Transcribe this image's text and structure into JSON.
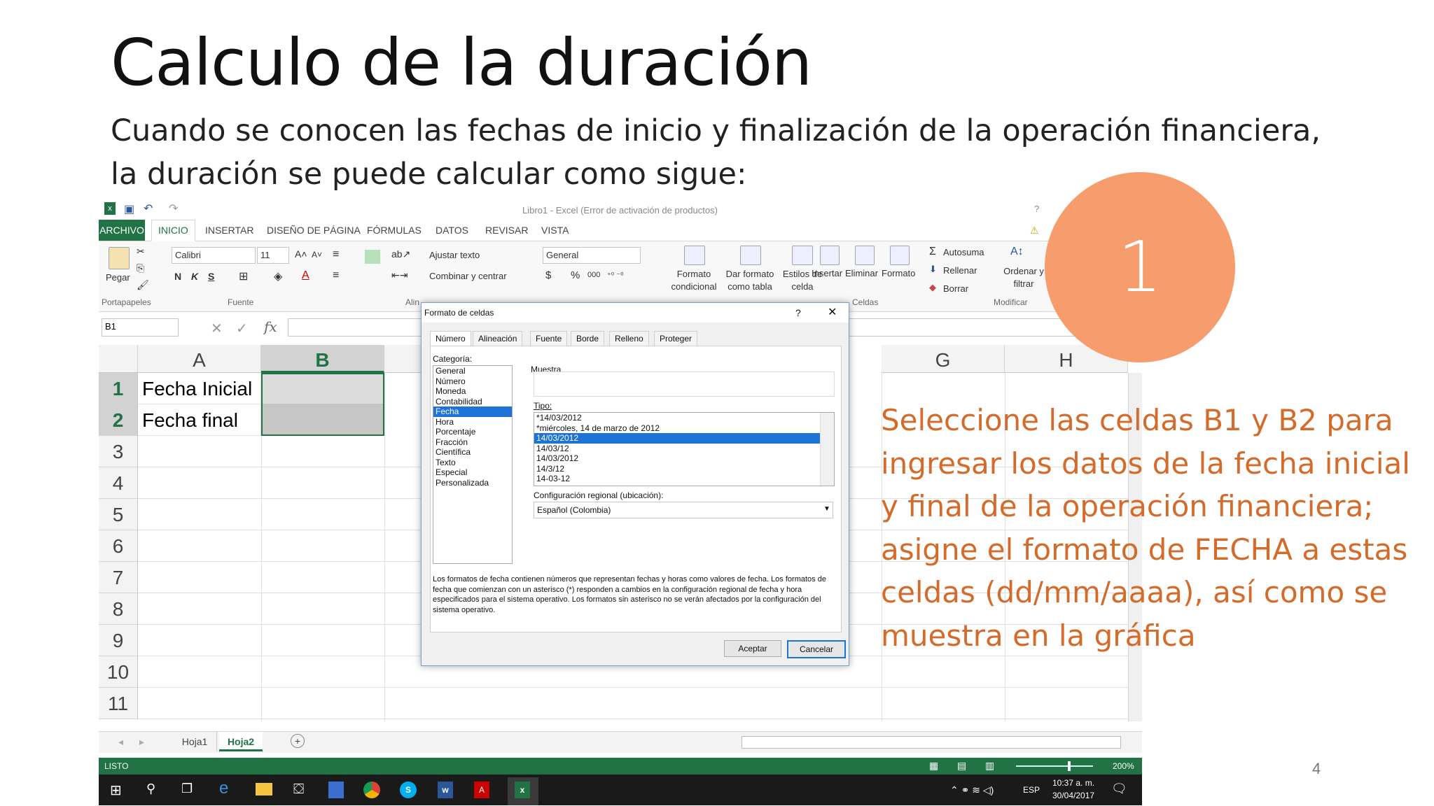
{
  "slide": {
    "title": "Calculo de la duración",
    "subtitle": "Cuando se conocen las fechas de inicio y finalización de la operación financiera, la duración se puede calcular como sigue:",
    "step_number": "1",
    "note": "Seleccione las celdas B1 y  B2 para ingresar los datos de la fecha inicial y final de la operación financiera; asigne el formato de FECHA a estas celdas (dd/mm/aaaa), así como se muestra en la gráfica",
    "page_number": "4",
    "accent_color": "#f79c6c",
    "note_color": "#d46b2a"
  },
  "excel": {
    "window_title": "Libro1 - Excel (Error de activación de productos)",
    "help": "?",
    "ribbon_tabs": [
      "ARCHIVO",
      "INICIO",
      "INSERTAR",
      "DISEÑO DE PÁGINA",
      "FÓRMULAS",
      "DATOS",
      "REVISAR",
      "VISTA"
    ],
    "paste_label": "Pegar",
    "font_name": "Calibri",
    "font_size": "11",
    "bold": "N",
    "italic": "K",
    "underline": "S",
    "wrap_text": "Ajustar texto",
    "merge_center": "Combinar y centrar",
    "number_format": "General",
    "currency": "$",
    "percent": "%",
    "thousands": "000",
    "cond_format": "Formato condicional",
    "format_table": "Dar formato como tabla",
    "cell_styles": "Estilos de celda",
    "insert": "Insertar",
    "delete": "Eliminar",
    "format": "Formato",
    "autosum": "Autosuma",
    "fill": "Rellenar",
    "clear": "Borrar",
    "sort_filter": "Ordenar y filtrar",
    "groups": [
      "Portapapeles",
      "Fuente",
      "Alin",
      "Celdas",
      "Modificar"
    ],
    "name_box": "B1",
    "fx": "fx",
    "columns": [
      "A",
      "B",
      "G",
      "H"
    ],
    "rows": [
      "1",
      "2",
      "3",
      "4",
      "5",
      "6",
      "7",
      "8",
      "9",
      "10",
      "11"
    ],
    "cells": {
      "A1": "Fecha Inicial",
      "A2": "Fecha final"
    },
    "sheets": [
      "Hoja1",
      "Hoja2"
    ],
    "active_sheet": "Hoja2",
    "status": "LISTO",
    "zoom": "200%",
    "tray": {
      "lang": "ESP",
      "time": "10:37 a. m.",
      "date": "30/04/2017"
    }
  },
  "dialog": {
    "title": "Formato de celdas",
    "tabs": [
      "Número",
      "Alineación",
      "Fuente",
      "Borde",
      "Relleno",
      "Proteger"
    ],
    "category_label": "Categoría:",
    "categories": [
      "General",
      "Número",
      "Moneda",
      "Contabilidad",
      "Fecha",
      "Hora",
      "Porcentaje",
      "Fracción",
      "Científica",
      "Texto",
      "Especial",
      "Personalizada"
    ],
    "selected_category": "Fecha",
    "sample_label": "Muestra",
    "type_label": "Tipo:",
    "types": [
      "*14/03/2012",
      "*miércoles, 14 de marzo de 2012",
      "14/03/2012",
      "14/03/12",
      "14/03/2012",
      "14/3/12",
      "14-03-12"
    ],
    "selected_type_index": 2,
    "locale_label": "Configuración regional (ubicación):",
    "locale_value": "Español (Colombia)",
    "description": "Los formatos de fecha contienen números que representan fechas y horas como valores de fecha. Los formatos de fecha que comienzan con un asterisco (*) responden a cambios en la configuración regional de fecha y hora especificados para el sistema operativo. Los formatos sin asterisco no se verán afectados por la configuración del sistema operativo.",
    "ok": "Aceptar",
    "cancel": "Cancelar"
  }
}
